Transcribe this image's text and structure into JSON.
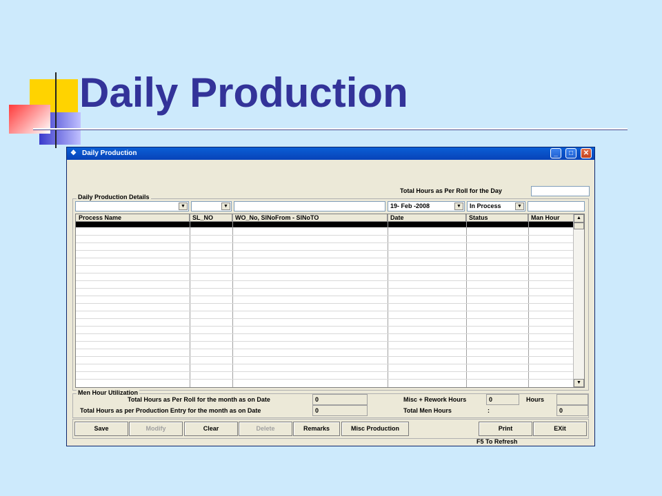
{
  "slide": {
    "title": "Daily Production"
  },
  "window": {
    "title": "Daily Production",
    "controls": {
      "minimize": "_",
      "maximize": "□",
      "close": "✕"
    },
    "total_hours_roll_day_label": "Total Hours as Per Roll for the Day",
    "total_hours_roll_day_value": "",
    "details_group_label": "Daily Production Details",
    "filters": {
      "process": "",
      "sl_no": "",
      "wo_range": "",
      "date": "19- Feb -2008",
      "status": "In Process",
      "man_hour": ""
    },
    "grid": {
      "columns": [
        "Process Name",
        "SL_NO",
        "WO_No, SlNoFrom - SlNoTO",
        "Date",
        "Status",
        "Man Hour"
      ],
      "rows": []
    },
    "utilization": {
      "group_label": "Men Hour Utilization",
      "roll_month_label": "Total Hours as Per Roll for the month as on Date",
      "roll_month_value": "0",
      "entry_month_label": "Total Hours as per Production Entry for the month as on Date",
      "entry_month_value": "0",
      "misc_rework_label": "Misc + Rework Hours",
      "misc_rework_value": "0",
      "hours_label": "Hours",
      "hours_value": "",
      "total_men_label": "Total Men Hours",
      "total_men_colon": ":",
      "total_men_value": "0"
    },
    "buttons": {
      "save": "Save",
      "modify": "Modify",
      "clear": "Clear",
      "delete": "Delete",
      "remarks": "Remarks",
      "misc_production": "Misc Production",
      "print": "Print",
      "exit": "EXit"
    },
    "footer_hint": "F5 To Refresh"
  },
  "colors": {
    "title": "#333399",
    "background": "#cdeafc",
    "titlebar": "#0a5fd6"
  }
}
